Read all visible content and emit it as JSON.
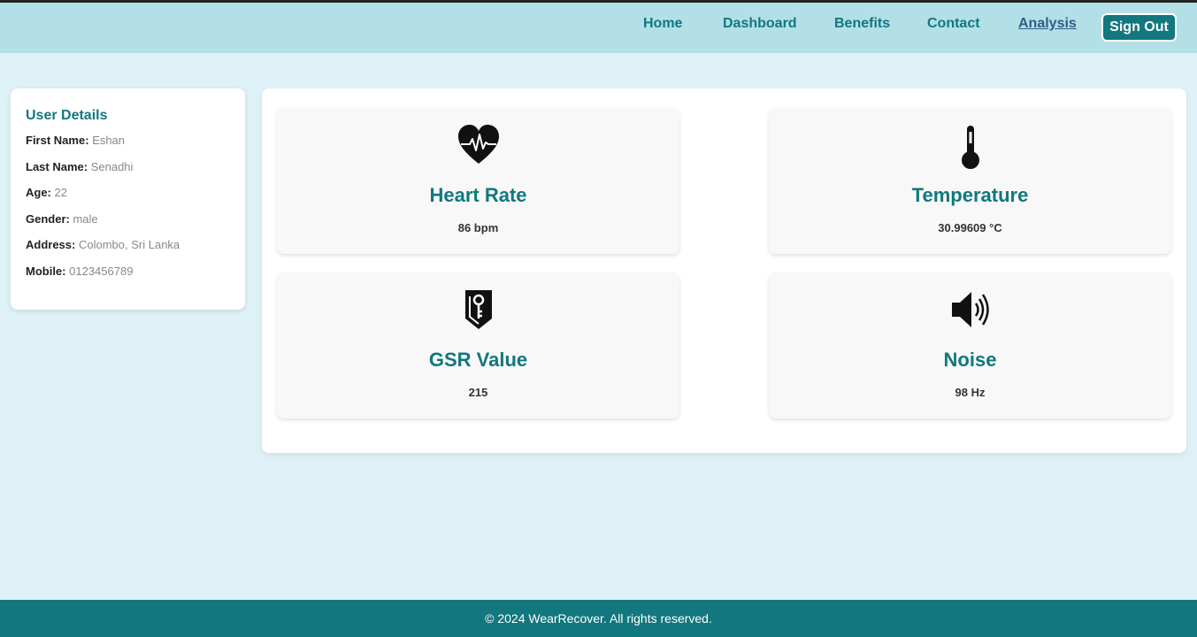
{
  "nav": {
    "items": [
      {
        "label": "Home"
      },
      {
        "label": "Dashboard"
      },
      {
        "label": "Benefits"
      },
      {
        "label": "Contact"
      },
      {
        "label": "Analysis"
      }
    ],
    "sign_out_label": "Sign Out"
  },
  "user_details": {
    "title": "User Details",
    "fields": [
      {
        "label": "First Name:",
        "value": "Eshan"
      },
      {
        "label": "Last Name:",
        "value": "Senadhi"
      },
      {
        "label": "Age:",
        "value": "22"
      },
      {
        "label": "Gender:",
        "value": "male"
      },
      {
        "label": "Address:",
        "value": "Colombo, Sri Lanka"
      },
      {
        "label": "Mobile:",
        "value": "0123456789"
      }
    ]
  },
  "metrics": [
    {
      "title": "Heart Rate",
      "value": "86 bpm",
      "icon": "heart-pulse-icon"
    },
    {
      "title": "Temperature",
      "value": "30.99609 °C",
      "icon": "thermometer-icon"
    },
    {
      "title": "GSR Value",
      "value": "215",
      "icon": "gsr-sensor-icon"
    },
    {
      "title": "Noise",
      "value": "98 Hz",
      "icon": "speaker-icon"
    }
  ],
  "footer": {
    "text": "© 2024 WearRecover. All rights reserved."
  },
  "colors": {
    "accent": "#12777f",
    "header_bg": "#b3dfe6",
    "page_bg": "#ddf1f7",
    "active_link": "#2e5f86"
  }
}
